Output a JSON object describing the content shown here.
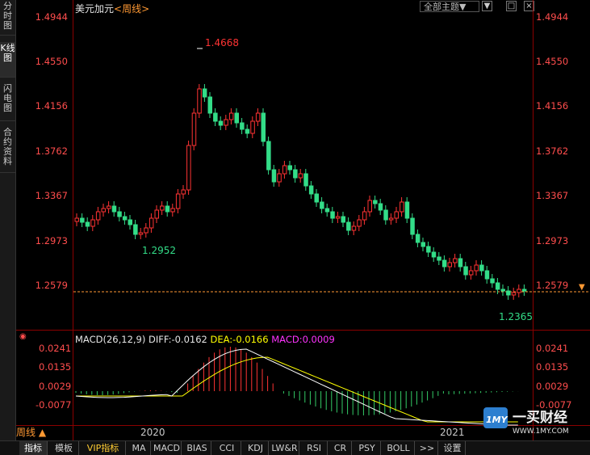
{
  "left_tabs": [
    {
      "label": "分时图",
      "active": false
    },
    {
      "label": "K线图",
      "active": true
    },
    {
      "label": "闪电图",
      "active": false
    },
    {
      "label": "合约资料",
      "active": false
    }
  ],
  "header": {
    "symbol": "美元加元",
    "period": "<周线>",
    "theme_dropdown": "全部主题▼",
    "window_buttons": [
      "▼",
      "□",
      "×"
    ]
  },
  "price_axis": {
    "labels": [
      "1.4944",
      "1.4550",
      "1.4156",
      "1.3762",
      "1.3367",
      "1.2973",
      "1.2579"
    ],
    "high_label": "1.4668",
    "low_label_1": "1.2952",
    "low_label_2": "1.2365",
    "current_marker": "▼"
  },
  "macd": {
    "params": "MACD(26,12,9)",
    "diff": "DIFF:-0.0162",
    "dea": "DEA:-0.0166",
    "macd": "MACD:0.0009",
    "axis_labels": [
      "0.0241",
      "0.0135",
      "0.0029",
      "-0.0077"
    ],
    "colors": {
      "diff": "#ffffff",
      "dea": "#ffff00",
      "up": "#ff3333",
      "down": "#33cc66"
    }
  },
  "period_button": "周线 ▲",
  "years": [
    "2020",
    "2021"
  ],
  "bottom_tabs": [
    {
      "label": "指标",
      "active": true
    },
    {
      "label": "模板",
      "active": false
    },
    {
      "label": "VIP指标",
      "vip": true
    },
    {
      "label": "MA"
    },
    {
      "label": "MACD"
    },
    {
      "label": "BIAS"
    },
    {
      "label": "CCI"
    },
    {
      "label": "KDJ"
    },
    {
      "label": "LW&R"
    },
    {
      "label": "RSI"
    },
    {
      "label": "CR"
    },
    {
      "label": "PSY"
    },
    {
      "label": "BOLL"
    },
    {
      "label": ">>"
    },
    {
      "label": "设置"
    }
  ],
  "watermark": {
    "logo": "1MY",
    "name": "一买财经",
    "url": "WWW.1MY.COM"
  },
  "colors": {
    "up": "#ff3333",
    "down": "#33dd88",
    "axis_text": "#ff4d4d",
    "frame": "#8b0000",
    "accent": "#ff9933"
  },
  "chart_data": {
    "type": "candlestick",
    "title": "美元加元 <周线>",
    "ylim": [
      1.2365,
      1.4944
    ],
    "high": 1.4668,
    "lows": [
      1.2952,
      1.2365
    ],
    "last_close": 1.2579
  }
}
